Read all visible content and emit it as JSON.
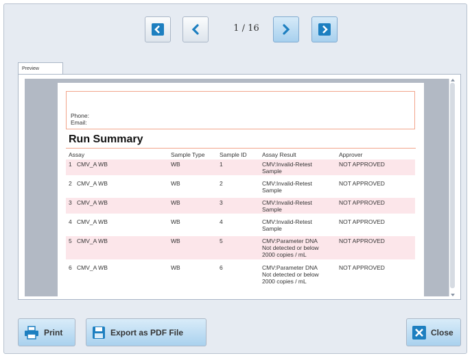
{
  "nav": {
    "page_counter": "1 / 16",
    "first_icon": "first-page-icon",
    "prev_icon": "previous-page-icon",
    "next_icon": "next-page-icon",
    "last_icon": "last-page-icon"
  },
  "preview_tab": {
    "label": "Preview"
  },
  "report": {
    "phone_label": "Phone:",
    "email_label": "Email:",
    "section_title": "Run Summary",
    "columns": [
      "Assay",
      "Sample Type",
      "Sample ID",
      "Assay Result",
      "Approver"
    ],
    "rows": [
      {
        "num": "1",
        "assay": "CMV_A WB",
        "sample_type": "WB",
        "sample_id": "1",
        "result": "CMV:Invalid-Retest\nSample",
        "approver": "NOT APPROVED"
      },
      {
        "num": "2",
        "assay": "CMV_A WB",
        "sample_type": "WB",
        "sample_id": "2",
        "result": "CMV:Invalid-Retest\nSample",
        "approver": "NOT APPROVED"
      },
      {
        "num": "3",
        "assay": "CMV_A WB",
        "sample_type": "WB",
        "sample_id": "3",
        "result": "CMV:Invalid-Retest\nSample",
        "approver": "NOT APPROVED"
      },
      {
        "num": "4",
        "assay": "CMV_A WB",
        "sample_type": "WB",
        "sample_id": "4",
        "result": "CMV:Invalid-Retest\nSample",
        "approver": "NOT APPROVED"
      },
      {
        "num": "5",
        "assay": "CMV_A WB",
        "sample_type": "WB",
        "sample_id": "5",
        "result": "CMV:Parameter DNA\nNot detected or below\n2000 copies / mL",
        "approver": "NOT APPROVED"
      },
      {
        "num": "6",
        "assay": "CMV_A WB",
        "sample_type": "WB",
        "sample_id": "6",
        "result": "CMV:Parameter DNA\nNot detected or below\n2000 copies / mL",
        "approver": "NOT APPROVED"
      }
    ]
  },
  "buttons": {
    "print": "Print",
    "export": "Export as PDF File",
    "close": "Close"
  },
  "colors": {
    "accent": "#1d7fc0",
    "row_shade": "#fce6ea",
    "rule": "#f2a48a"
  }
}
